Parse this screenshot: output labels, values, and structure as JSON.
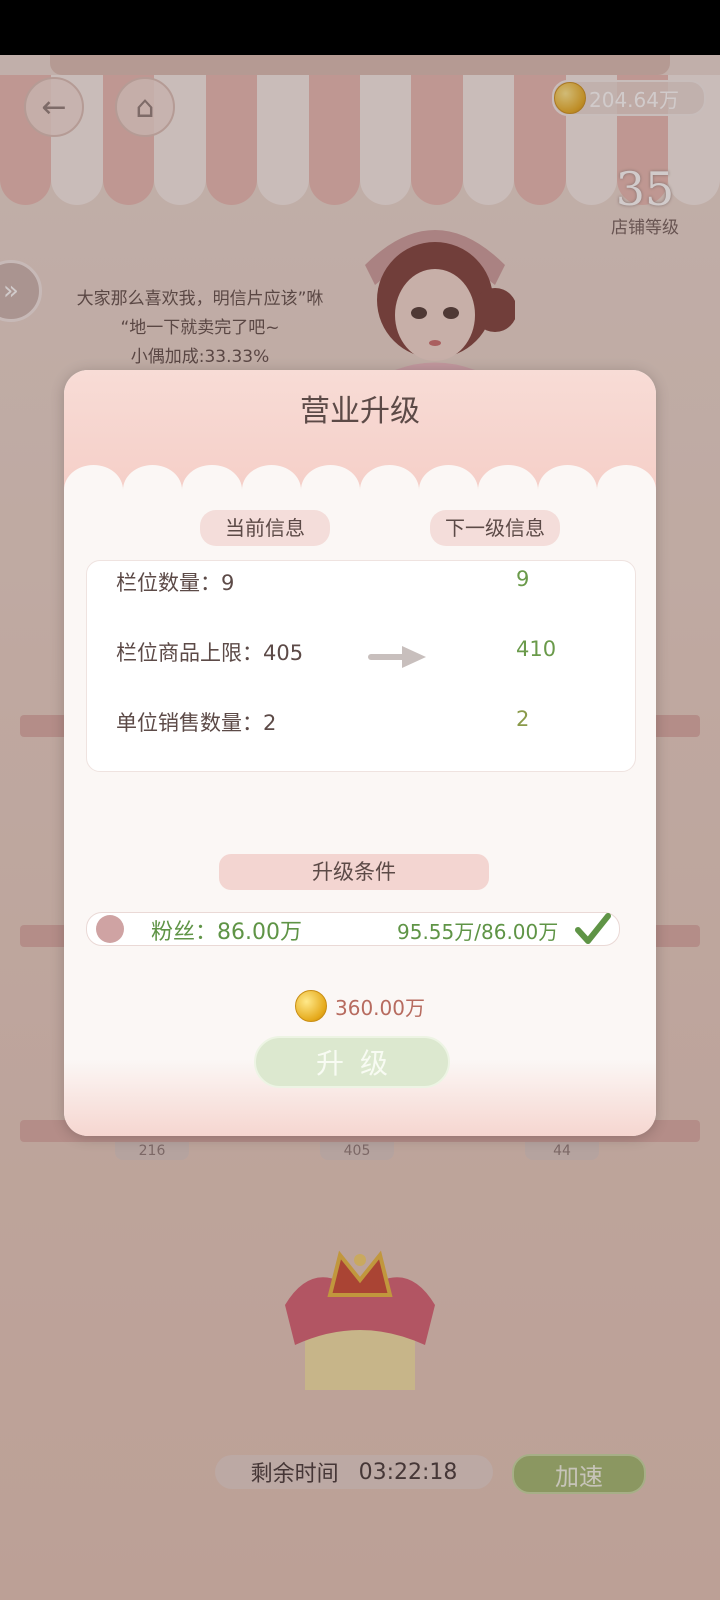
{
  "currency": {
    "balance": "204.64万"
  },
  "shop": {
    "level_number": "35",
    "level_label": "店铺等级"
  },
  "speech": {
    "line1": "大家那么喜欢我，明信片应该”咻",
    "line2": "“地一下就卖完了吧~",
    "line3": "小偶加成:33.33%"
  },
  "shelf_labels": [
    "216",
    "405",
    "44"
  ],
  "timer": {
    "label": "剩余时间",
    "value": "03:22:18"
  },
  "speed_button": "加速",
  "modal": {
    "title": "营业升级",
    "current_header": "当前信息",
    "next_header": "下一级信息",
    "rows": [
      {
        "label": "栏位数量：9",
        "next": "9"
      },
      {
        "label": "栏位商品上限：405",
        "next": "410"
      },
      {
        "label": "单位销售数量：2",
        "next": "2"
      }
    ],
    "conditions_header": "升级条件",
    "condition": {
      "label": "粉丝：86.00万",
      "progress": "95.55万/86.00万"
    },
    "cost": "360.00万",
    "upgrade_button": "升级"
  }
}
